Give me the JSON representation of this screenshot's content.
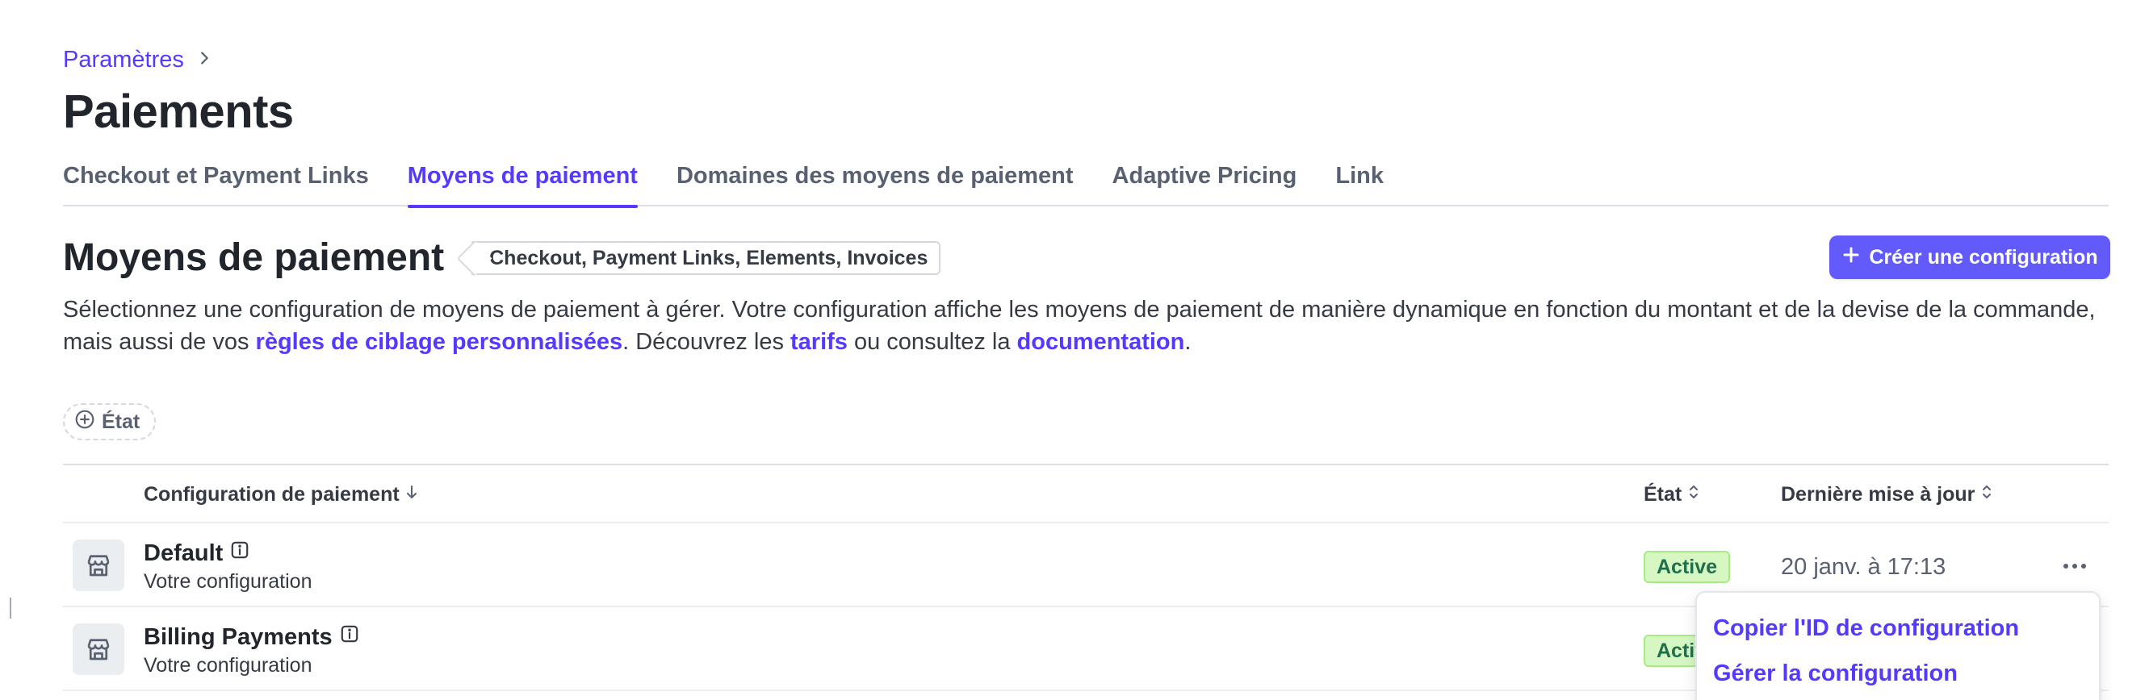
{
  "breadcrumb": {
    "parent": "Paramètres"
  },
  "page": {
    "title": "Paiements"
  },
  "tabs": [
    {
      "label": "Checkout et Payment Links",
      "active": false
    },
    {
      "label": "Moyens de paiement",
      "active": true
    },
    {
      "label": "Domaines des moyens de paiement",
      "active": false
    },
    {
      "label": "Adaptive Pricing",
      "active": false
    },
    {
      "label": "Link",
      "active": false
    }
  ],
  "section": {
    "title": "Moyens de paiement",
    "tag": "Checkout, Payment Links, Elements, Invoices",
    "create_button": "Créer une configuration",
    "description": {
      "part1": "Sélectionnez une configuration de moyens de paiement à gérer. Votre configuration affiche les moyens de paiement de manière dynamique en fonction du montant et de la devise de la commande, mais aussi de vos ",
      "link1": "règles de ciblage personnalisées",
      "part2": ". Découvrez les ",
      "link2": "tarifs",
      "part3": " ou consultez la ",
      "link3": "documentation",
      "part4": "."
    }
  },
  "filter": {
    "label": "État"
  },
  "table": {
    "columns": {
      "config": "Configuration de paiement",
      "status": "État",
      "updated": "Dernière mise à jour"
    },
    "rows": [
      {
        "name": "Default",
        "subtitle": "Votre configuration",
        "status": "Active",
        "updated": "20 janv. à 17:13"
      },
      {
        "name": "Billing Payments",
        "subtitle": "Votre configuration",
        "status": "Active",
        "updated": ""
      }
    ]
  },
  "menu": {
    "items": [
      "Copier l'ID de configuration",
      "Gérer la configuration"
    ]
  },
  "colors": {
    "accent": "#533afd",
    "button": "#625afa",
    "badge_bg": "#d7f7c2",
    "badge_text": "#216e4e"
  },
  "icons": {
    "breadcrumb_separator": "chevron-right-icon",
    "create": "plus-icon",
    "filter": "plus-circle-icon",
    "sort": "sort-icon",
    "row": "storefront-icon",
    "info": "info-icon",
    "more": "more-horizontal-icon"
  }
}
